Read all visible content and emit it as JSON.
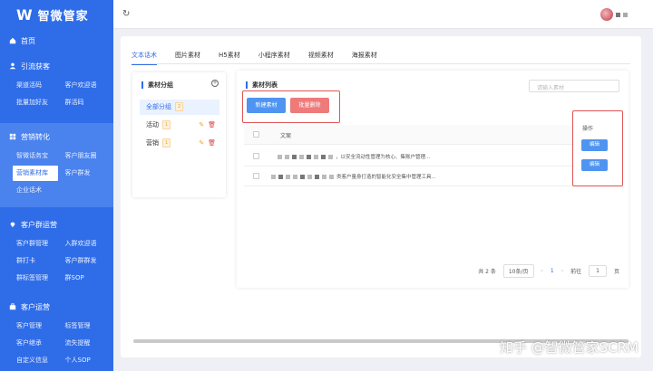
{
  "app": {
    "logo_mark": "W",
    "name": "智微管家"
  },
  "sidebar": {
    "home": "首页",
    "groups": [
      {
        "title": "引流获客",
        "items": [
          "渠道活码",
          "客户欢迎语",
          "批量加好友",
          "群活码"
        ]
      },
      {
        "title": "营销转化",
        "items": [
          "智微话务宝",
          "客户朋友圈",
          "营销素材库",
          "客户群发",
          "企业话术"
        ],
        "active_item": "营销素材库"
      },
      {
        "title": "客户群运营",
        "items": [
          "客户群管理",
          "入群欢迎语",
          "群打卡",
          "客户群群发",
          "群标签管理",
          "群SOP"
        ]
      },
      {
        "title": "客户运营",
        "items": [
          "客户管理",
          "标签管理",
          "客户继承",
          "流失提醒",
          "自定义信息",
          "个人SOP"
        ]
      }
    ]
  },
  "topbar": {
    "refresh_icon": "↻"
  },
  "tabs": [
    "文本话术",
    "图片素材",
    "H5素材",
    "小程序素材",
    "视频素材",
    "海报素材"
  ],
  "active_tab": "文本话术",
  "groups_panel": {
    "title": "素材分组",
    "add_icon": "+",
    "items": [
      {
        "label": "全部分组",
        "count": "2"
      },
      {
        "label": "活动",
        "count": "1"
      },
      {
        "label": "营销",
        "count": "1"
      }
    ]
  },
  "list_panel": {
    "title": "素材列表",
    "search_placeholder": "请输入素材",
    "new_button": "新建素材",
    "batch_delete_button": "批量删除",
    "column_text": "文案",
    "operation_label": "操作",
    "rows": [
      {
        "text": "，以安全流动性管理为核心、集账户管理..."
      },
      {
        "text": "类客户量身打造的智能化安全集中管理工具..."
      }
    ],
    "edit_label": "编辑"
  },
  "pagination": {
    "total": "共 2 条",
    "page_size": "10条/页",
    "prev": "‹",
    "next": "›",
    "current": "1",
    "goto_label": "前往",
    "goto_value": "1",
    "page_unit": "页"
  },
  "watermark": "知乎 @智微管家SCRM"
}
